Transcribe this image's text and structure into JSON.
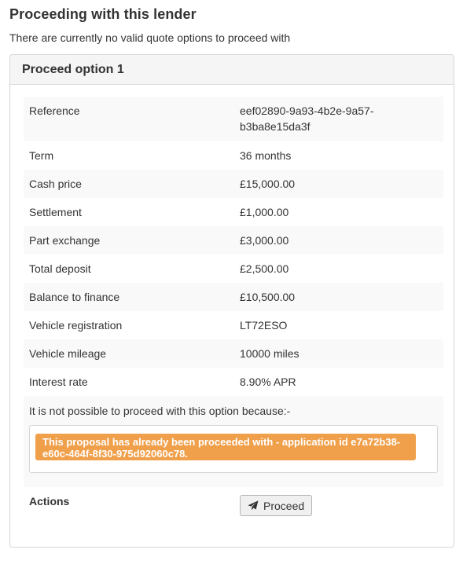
{
  "header": {
    "title": "Proceeding with this lender",
    "subtitle": "There are currently no valid quote options to proceed with"
  },
  "option": {
    "heading": "Proceed option 1",
    "details": [
      {
        "label": "Reference",
        "value": "eef02890-9a93-4b2e-9a57-b3ba8e15da3f"
      },
      {
        "label": "Term",
        "value": "36 months"
      },
      {
        "label": "Cash price",
        "value": "£15,000.00"
      },
      {
        "label": "Settlement",
        "value": "£1,000.00"
      },
      {
        "label": "Part exchange",
        "value": "£3,000.00"
      },
      {
        "label": "Total deposit",
        "value": "£2,500.00"
      },
      {
        "label": "Balance to finance",
        "value": "£10,500.00"
      },
      {
        "label": "Vehicle registration",
        "value": "LT72ESO"
      },
      {
        "label": "Vehicle mileage",
        "value": "10000 miles"
      },
      {
        "label": "Interest rate",
        "value": "8.90% APR"
      }
    ],
    "reason_intro": "It is not possible to proceed with this option because:-",
    "reason_alert": "This proposal has already been proceeded with - application id e7a72b38-e60c-464f-8f30-975d92060c78.",
    "actions_label": "Actions",
    "proceed_button": "Proceed",
    "proceed_icon": "paper-plane-icon"
  },
  "colors": {
    "alert_bg": "#f0a04b",
    "stripe_bg": "#f9f9f9",
    "panel_heading_bg": "#f5f5f5"
  }
}
